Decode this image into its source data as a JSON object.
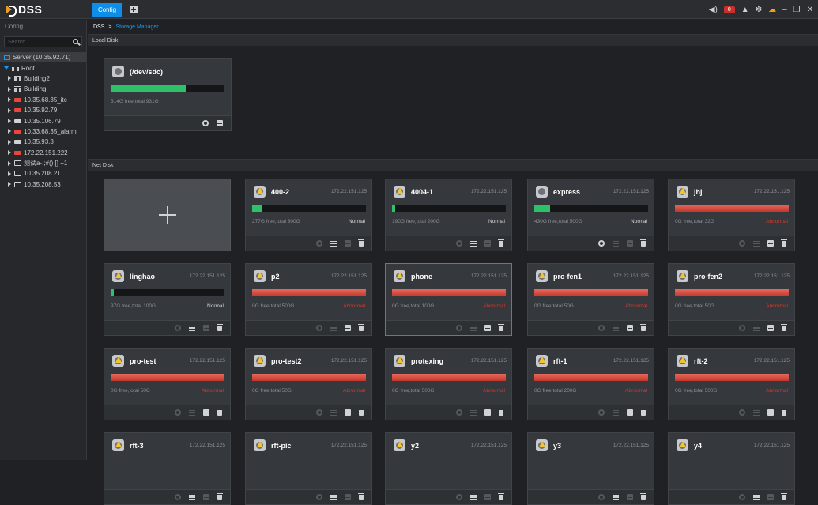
{
  "app": {
    "logo_text": "DSS",
    "active_tab": "Config"
  },
  "topbar": {
    "alarm_count": "0"
  },
  "sidebar": {
    "title": "Config",
    "search_placeholder": "Search...",
    "tree": [
      {
        "label": "Server (10.35.92.71)",
        "icon": "server-icon",
        "selected": true,
        "indent": 0
      },
      {
        "label": "Root",
        "icon": "org-icon",
        "expanded": true,
        "indent": 0
      },
      {
        "label": "Building2",
        "icon": "org-icon",
        "indent": 1
      },
      {
        "label": "Building",
        "icon": "org-icon",
        "indent": 1
      },
      {
        "label": "10.35.68.35_itc",
        "icon": "device-red-icon",
        "indent": 1
      },
      {
        "label": "10.35.92.79",
        "icon": "device-red-icon",
        "indent": 1
      },
      {
        "label": "10.35.106.79",
        "icon": "device-icon",
        "indent": 1
      },
      {
        "label": "10.33.68.35_alarm",
        "icon": "device-red-icon",
        "indent": 1
      },
      {
        "label": "10.35.93.3",
        "icon": "device-icon",
        "indent": 1
      },
      {
        "label": "172.22.151.222",
        "icon": "device-red-icon",
        "indent": 1
      },
      {
        "label": "测试a-.;#() [] +1",
        "icon": "device-box-red-icon",
        "indent": 1
      },
      {
        "label": "10.35.208.21",
        "icon": "device-box-icon",
        "indent": 1
      },
      {
        "label": "10.35.208.53",
        "icon": "device-box-icon",
        "indent": 1
      }
    ]
  },
  "breadcrumb": {
    "root": "DSS",
    "separator": ">",
    "current": "Storage Manager"
  },
  "local_disk": {
    "title": "Local Disk",
    "disks": [
      {
        "name": "(/dev/sdc)",
        "info": "314G free,total 931G",
        "used_fraction": 0.66
      }
    ]
  },
  "net_disk": {
    "title": "Net Disk",
    "disks": [
      {
        "name": "400-2",
        "ip": "172.22.151.125",
        "info": "277G free,total 300G",
        "status": "Normal",
        "used_fraction": 0.08,
        "error": false,
        "warn": true
      },
      {
        "name": "4004-1",
        "ip": "172.22.151.125",
        "info": "190G free,total 200G",
        "status": "Normal",
        "used_fraction": 0.01,
        "error": false,
        "warn": true
      },
      {
        "name": "express",
        "ip": "172.22.151.125",
        "info": "430G free,total 500G",
        "status": "Normal",
        "used_fraction": 0.14,
        "error": false,
        "warn": false
      },
      {
        "name": "jhj",
        "ip": "172.22.151.125",
        "info": "0G free,total 32G",
        "status": "Abnormal",
        "used_fraction": 1,
        "error": true,
        "warn": true
      },
      {
        "name": "linghao",
        "ip": "172.22.151.125",
        "info": "97G free,total 100G",
        "status": "Normal",
        "used_fraction": 0.03,
        "error": false,
        "warn": true
      },
      {
        "name": "p2",
        "ip": "172.22.151.125",
        "info": "0G free,total 500G",
        "status": "Abnormal",
        "used_fraction": 1,
        "error": true,
        "warn": true
      },
      {
        "name": "phone",
        "ip": "172.22.151.125",
        "info": "0G free,total 100G",
        "status": "Abnormal",
        "used_fraction": 1,
        "error": true,
        "warn": true,
        "selected": true
      },
      {
        "name": "pro-fen1",
        "ip": "172.22.151.125",
        "info": "0G free,total 50G",
        "status": "Abnormal",
        "used_fraction": 1,
        "error": true,
        "warn": true
      },
      {
        "name": "pro-fen2",
        "ip": "172.22.151.125",
        "info": "0G free,total 50G",
        "status": "Abnormal",
        "used_fraction": 1,
        "error": true,
        "warn": true
      },
      {
        "name": "pro-test",
        "ip": "172.22.151.125",
        "info": "0G free,total 50G",
        "status": "Abnormal",
        "used_fraction": 1,
        "error": true,
        "warn": true
      },
      {
        "name": "pro-test2",
        "ip": "172.22.151.125",
        "info": "0G free,total 50G",
        "status": "Abnormal",
        "used_fraction": 1,
        "error": true,
        "warn": true
      },
      {
        "name": "protexing",
        "ip": "172.22.151.125",
        "info": "0G free,total 500G",
        "status": "Abnormal",
        "used_fraction": 1,
        "error": true,
        "warn": true
      },
      {
        "name": "rft-1",
        "ip": "172.22.151.125",
        "info": "0G free,total 200G",
        "status": "Abnormal",
        "used_fraction": 1,
        "error": true,
        "warn": true
      },
      {
        "name": "rft-2",
        "ip": "172.22.151.125",
        "info": "0G free,total 500G",
        "status": "Abnormal",
        "used_fraction": 1,
        "error": true,
        "warn": true
      },
      {
        "name": "rft-3",
        "ip": "172.22.151.125",
        "warn": true
      },
      {
        "name": "rft-pic",
        "ip": "172.22.151.125",
        "warn": true
      },
      {
        "name": "y2",
        "ip": "172.22.151.125",
        "warn": true
      },
      {
        "name": "y3",
        "ip": "172.22.151.125",
        "warn": true
      },
      {
        "name": "y4",
        "ip": "172.22.151.125",
        "warn": true
      }
    ]
  },
  "colors": {
    "accent": "#0f8ee9",
    "ok_bar": "#2fc169",
    "error_bar": "#c5362b"
  }
}
